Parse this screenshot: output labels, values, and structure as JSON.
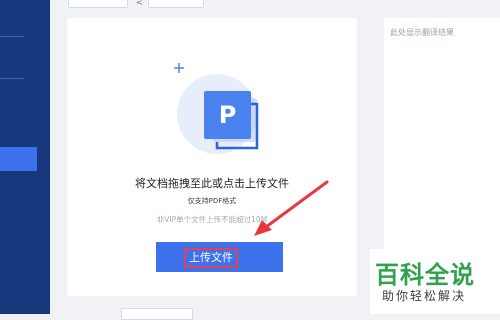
{
  "result_panel": {
    "placeholder": "此处显示翻译结果"
  },
  "upload": {
    "title": "将文档拖拽至此或点击上传文件",
    "supported_formats": "仅支持PDF格式",
    "vip_note": "非VIP单个文件上传不能超过10M",
    "button_label": "上传文件",
    "file_badge_letter": "P"
  },
  "watermark": {
    "logo": "百科全说",
    "slogan": "助你轻松解决"
  },
  "colors": {
    "sidebar": "#17387d",
    "accent": "#3e72ec",
    "highlight_box": "#e04352",
    "watermark_green": "#30a14d"
  },
  "icons": {
    "illustration": "pdf-file-icon",
    "annotation": "red-arrow-annotation",
    "decoration": "plus-sparkle-icon"
  }
}
